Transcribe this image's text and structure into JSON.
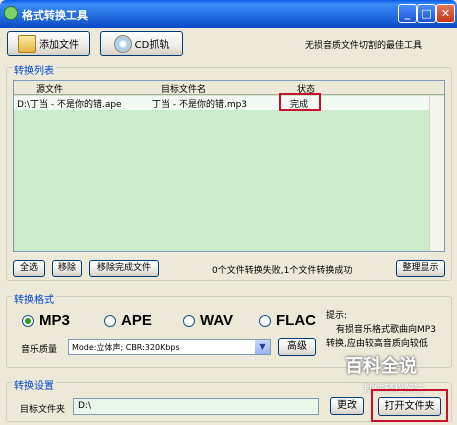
{
  "window": {
    "title": "格式转换工具",
    "buttons": {
      "minimize": "_",
      "maximize": "□",
      "close": "✕"
    }
  },
  "toolbar": {
    "add_file": "添加文件",
    "cd_rip": "CD抓轨",
    "slogan": "无损音质文件切割的最佳工具"
  },
  "list": {
    "section_label": "转换列表",
    "columns": [
      "源文件",
      "目标文件名",
      "状态"
    ],
    "rows": [
      {
        "source": "D:\\丁当 - 不是你的错.ape",
        "target": "丁当 - 不是你的错.mp3",
        "status": "完成"
      }
    ]
  },
  "actions": {
    "select_all": "全选",
    "remove": "移除",
    "remove_done": "移除完成文件",
    "summary": "0个文件转换失败,1个文件转换成功",
    "tidy": "整理显示"
  },
  "format": {
    "section_label": "转换格式",
    "options": [
      "MP3",
      "APE",
      "WAV",
      "FLAC"
    ],
    "selected": "MP3",
    "quality_label": "音乐质量",
    "quality_value": "Mode:立体声; CBR:320Kbps",
    "advanced": "高级",
    "hint_title": "提示:",
    "hint_line1": "有损音乐格式歌曲向MP3",
    "hint_line2": "转换,应由较高音质向较低"
  },
  "settings": {
    "section_label": "转换设置",
    "target_folder_label": "目标文件夹",
    "target_folder_value": "D:\\",
    "change": "更改",
    "open_folder": "打开文件夹"
  },
  "watermark": {
    "title": "百科全说",
    "subtitle": "助你轻松解决"
  },
  "colors": {
    "accent": "#0046d5",
    "highlight": "#c8102e",
    "list_bg": "#cceacc"
  }
}
